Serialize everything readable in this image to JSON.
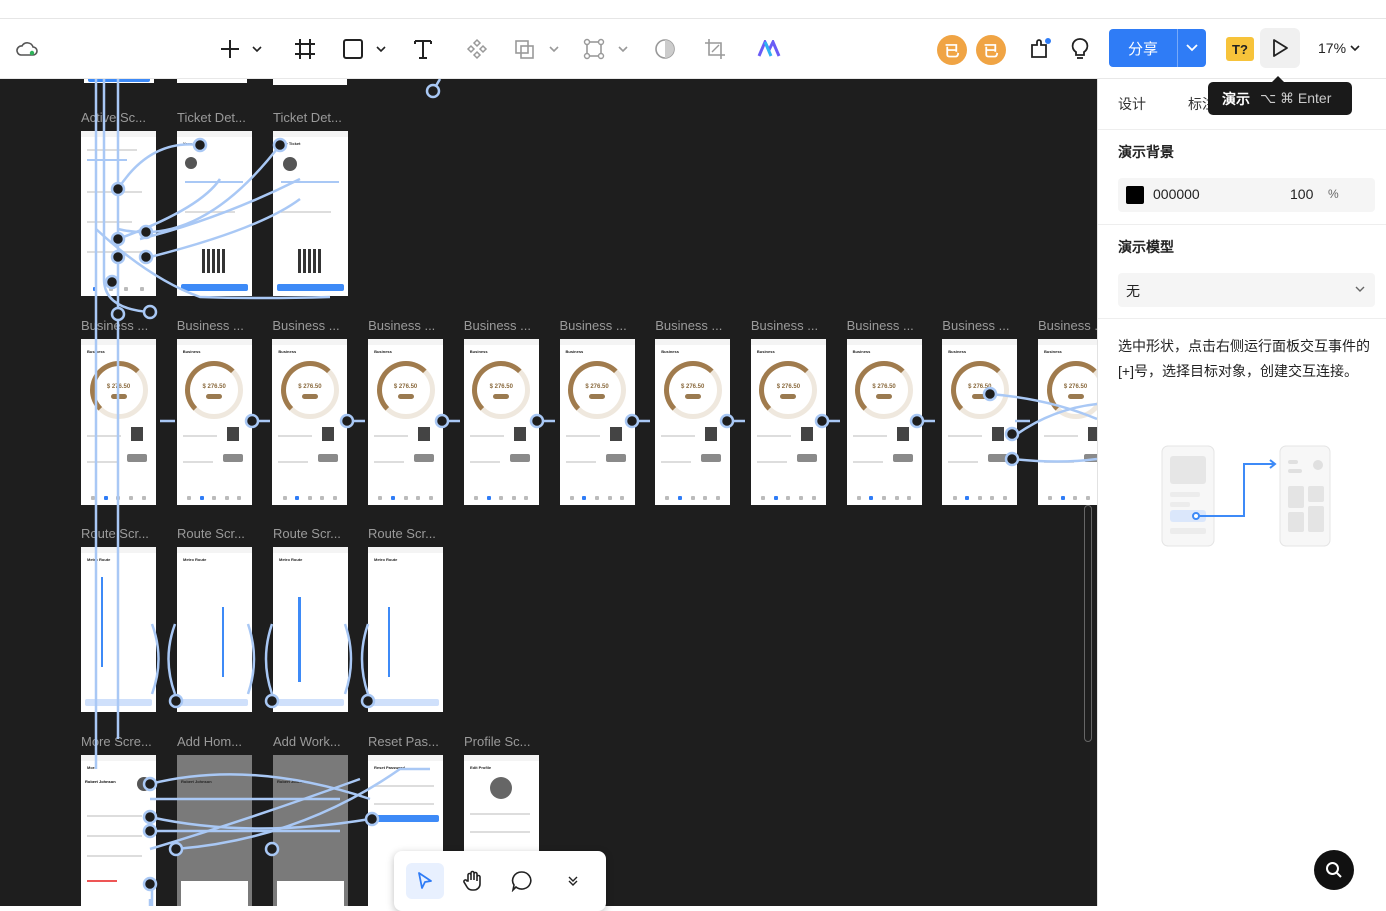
{
  "toolbar": {
    "avatars": [
      "已",
      "已"
    ],
    "share_label": "分享",
    "tq_label": "T?",
    "zoom": "17%"
  },
  "tooltip": {
    "label": "演示",
    "shortcut": "⌥ ⌘ Enter"
  },
  "sidebar": {
    "tabs": [
      "设计",
      "标注"
    ],
    "bg_title": "演示背景",
    "bg_color": "000000",
    "bg_opacity": "100",
    "bg_opacity_unit": "%",
    "model_title": "演示模型",
    "model_value": "无",
    "help_text": "选中形状，点击右侧运行面板交互事件的[+]号，选择目标对象，创建交互连接。"
  },
  "canvas": {
    "row1_labels": [
      "Active Sc...",
      "Ticket Det...",
      "Ticket Det..."
    ],
    "row2_labels": [
      "Business ...",
      "Business ...",
      "Business ...",
      "Business ...",
      "Business ...",
      "Business ...",
      "Business ...",
      "Business ...",
      "Business ...",
      "Business ...",
      "Business ..."
    ],
    "row3_labels": [
      "Route Scr...",
      "Route Scr...",
      "Route Scr...",
      "Route Scr..."
    ],
    "row4_labels": [
      "More Scre...",
      "Add Hom...",
      "Add Work...",
      "Reset Pas...",
      "Profile Sc..."
    ],
    "business_amount": "$ 276.50",
    "screen_titles": {
      "business": "Business",
      "route": "Metro Route",
      "more": "More",
      "profile": "Edit Profile",
      "reset": "Reset Password",
      "ticket": "Your Ticket",
      "user_name": "Robert Johnson"
    }
  },
  "colors": {
    "accent": "#2f7cf6",
    "canvas_bg": "#1e1e1e",
    "avatar": "#f0a444",
    "flow_line": "#a9c8f5"
  },
  "icons": {
    "cloud": "cloud-sync-icon",
    "add": "plus-icon",
    "frame": "frame-icon",
    "rect": "rectangle-icon",
    "text": "text-icon",
    "component": "component-icon",
    "boolean": "boolean-icon",
    "vector": "vector-icon",
    "mask": "mask-icon",
    "crop": "crop-icon",
    "ai": "ai-logo-icon",
    "plugin": "plugin-icon",
    "bulb": "bulb-icon",
    "play": "play-icon",
    "cursor": "cursor-icon",
    "hand": "hand-icon",
    "comment": "comment-icon",
    "search": "search-icon"
  }
}
